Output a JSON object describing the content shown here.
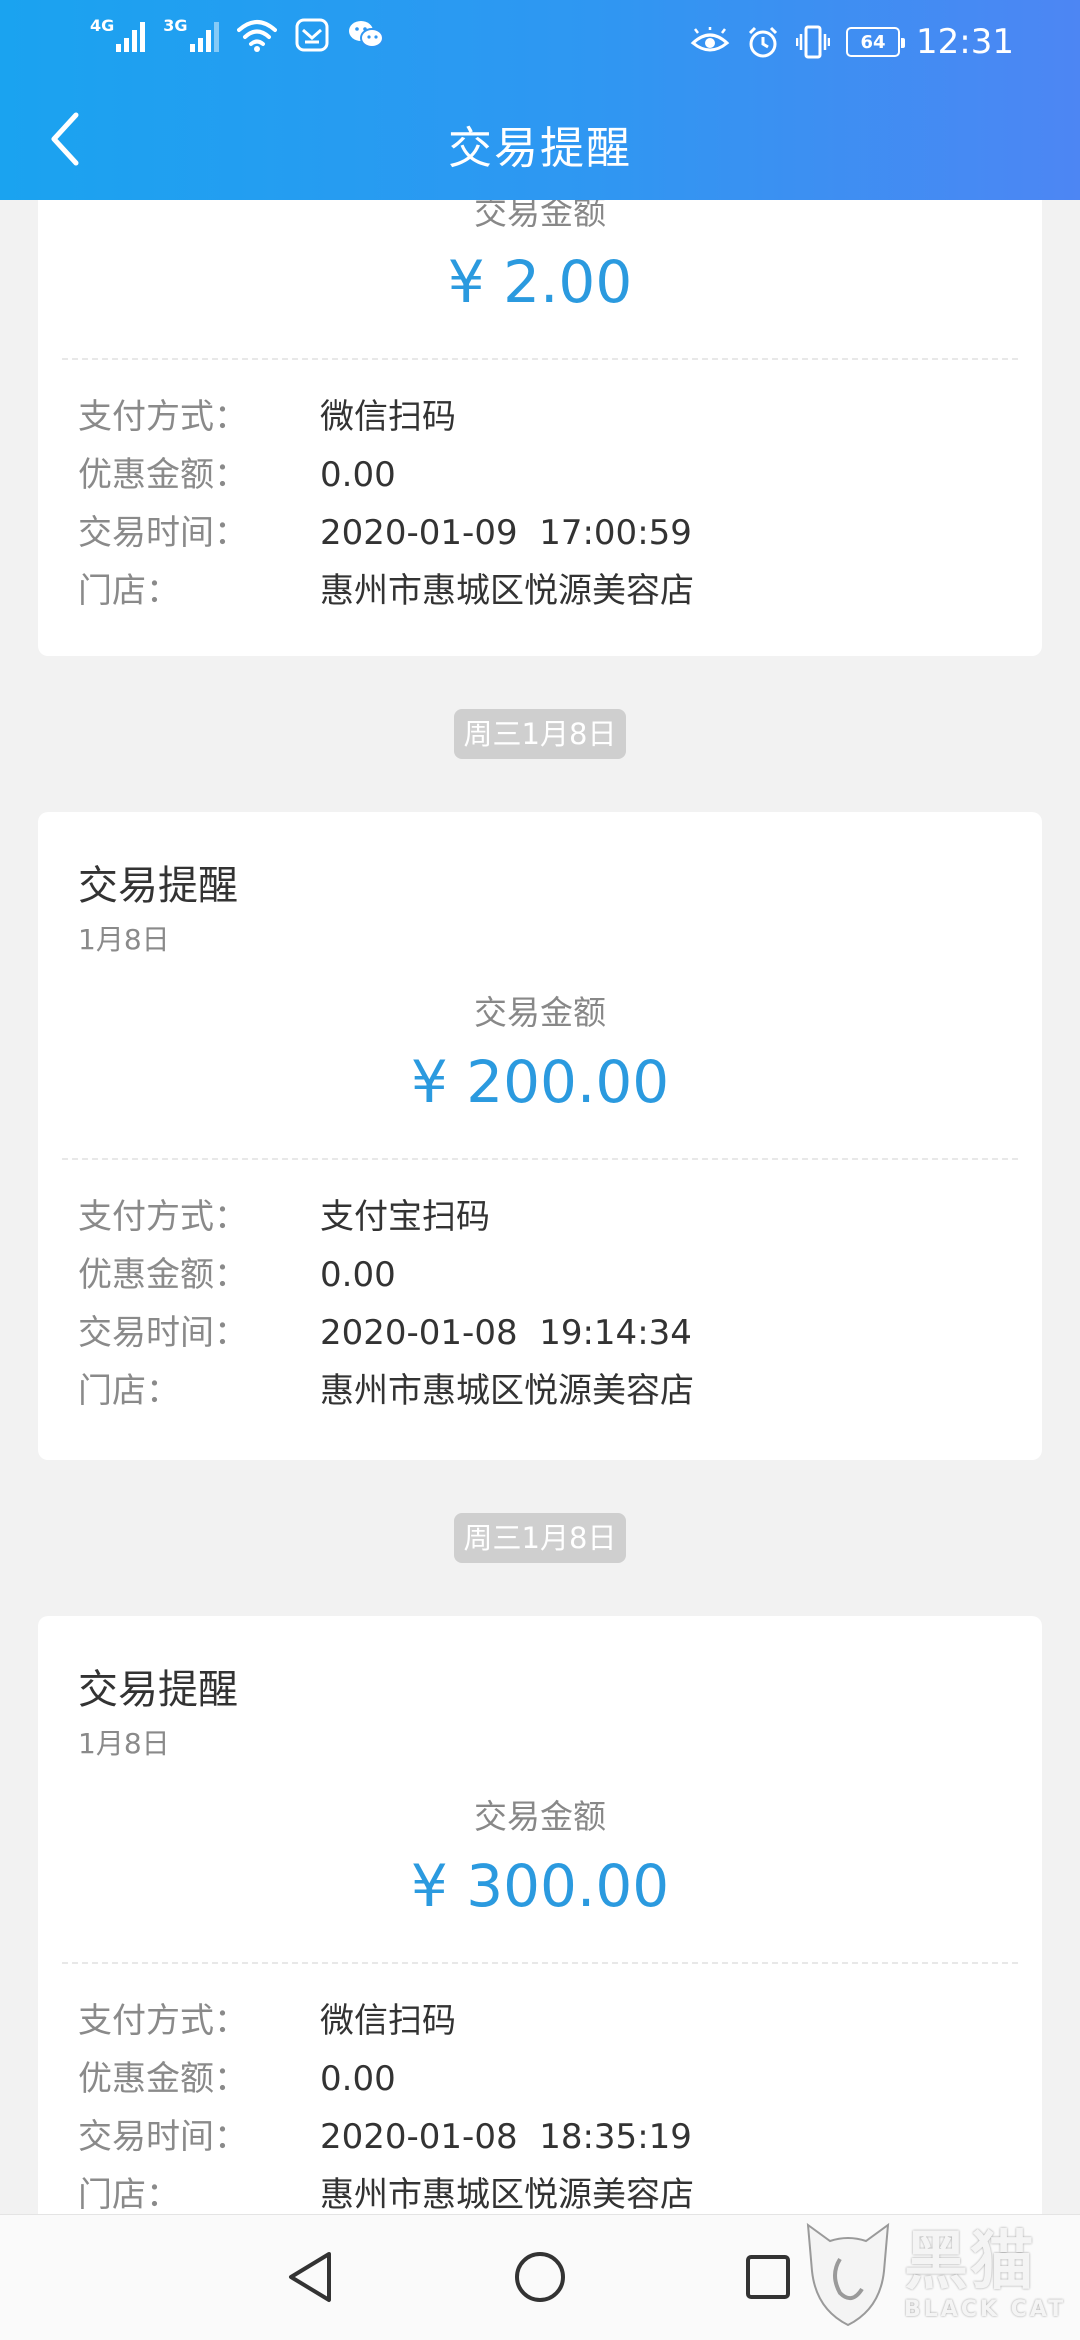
{
  "status_bar": {
    "network1": "4G",
    "network2": "3G",
    "battery": "64",
    "time": "12:31"
  },
  "header": {
    "title": "交易提醒"
  },
  "cards": [
    {
      "partial": true,
      "amount_label": "交易金额",
      "amount": "¥ 2.00",
      "details": [
        {
          "label": "支付方式：",
          "value": "微信扫码"
        },
        {
          "label": "优惠金额：",
          "value": "0.00"
        },
        {
          "label": "交易时间：",
          "value": "2020-01-09  17:00:59"
        },
        {
          "label": "门店：",
          "value": "惠州市惠城区悦源美容店"
        }
      ]
    },
    {
      "date_chip": "周三1月8日",
      "title": "交易提醒",
      "date": "1月8日",
      "amount_label": "交易金额",
      "amount": "¥ 200.00",
      "details": [
        {
          "label": "支付方式：",
          "value": "支付宝扫码"
        },
        {
          "label": "优惠金额：",
          "value": "0.00"
        },
        {
          "label": "交易时间：",
          "value": "2020-01-08  19:14:34"
        },
        {
          "label": "门店：",
          "value": "惠州市惠城区悦源美容店"
        }
      ]
    },
    {
      "date_chip": "周三1月8日",
      "title": "交易提醒",
      "date": "1月8日",
      "amount_label": "交易金额",
      "amount": "¥ 300.00",
      "details": [
        {
          "label": "支付方式：",
          "value": "微信扫码"
        },
        {
          "label": "优惠金额：",
          "value": "0.00"
        },
        {
          "label": "交易时间：",
          "value": "2020-01-08  18:35:19"
        },
        {
          "label": "门店：",
          "value": "惠州市惠城区悦源美容店"
        }
      ]
    }
  ],
  "watermark": {
    "cn": "黑猫",
    "en": "BLACK CAT"
  },
  "icons": {
    "back": "chevron-left-icon",
    "nav_back": "triangle-back-icon",
    "nav_home": "circle-home-icon",
    "nav_recent": "square-recent-icon"
  },
  "colors": {
    "header_start": "#1aa3f0",
    "header_end": "#4d86f3",
    "amount": "#2b9adf",
    "background": "#f2f2f2"
  }
}
